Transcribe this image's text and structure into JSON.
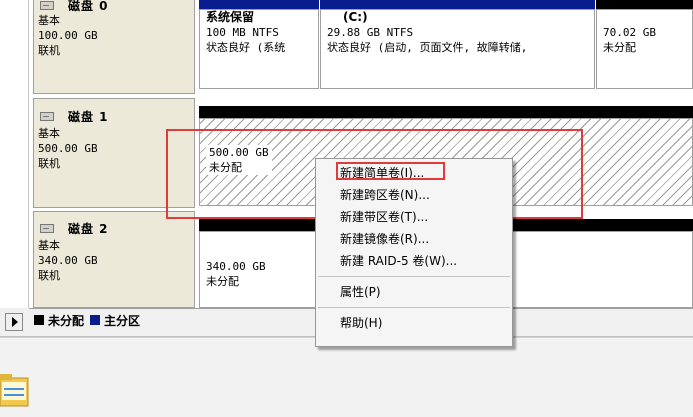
{
  "disks": [
    {
      "name": "磁盘 0",
      "type": "基本",
      "size": "100.00 GB",
      "status": "联机",
      "partitions": [
        {
          "name": "系统保留",
          "detail": "100 MB NTFS",
          "status": "状态良好 (系统"
        },
        {
          "name": "(C:)",
          "detail": "29.88 GB NTFS",
          "status": "状态良好 (启动, 页面文件, 故障转储,"
        },
        {
          "name": "",
          "detail": "70.02 GB",
          "status": "未分配"
        }
      ]
    },
    {
      "name": "磁盘 1",
      "type": "基本",
      "size": "500.00 GB",
      "status": "联机",
      "partitions": [
        {
          "name": "",
          "detail": "500.00 GB",
          "status": "未分配"
        }
      ]
    },
    {
      "name": "磁盘 2",
      "type": "基本",
      "size": "340.00 GB",
      "status": "联机",
      "partitions": [
        {
          "name": "",
          "detail": "340.00 GB",
          "status": "未分配"
        }
      ]
    }
  ],
  "legend": [
    {
      "label": "未分配",
      "color": "#000000"
    },
    {
      "label": "主分区",
      "color": "#0a1d8f"
    }
  ],
  "context_menu": {
    "items": [
      {
        "label": "新建简单卷(I)...",
        "highlighted": true
      },
      {
        "label": "新建跨区卷(N)..."
      },
      {
        "label": "新建带区卷(T)..."
      },
      {
        "label": "新建镜像卷(R)..."
      },
      {
        "label": "新建 RAID-5 卷(W)..."
      },
      {
        "label": "属性(P)"
      },
      {
        "label": "帮助(H)"
      }
    ]
  },
  "colors": {
    "primary_partition": "#0a1d8f",
    "unallocated": "#000000",
    "annotation_red": "#e03a3a"
  }
}
